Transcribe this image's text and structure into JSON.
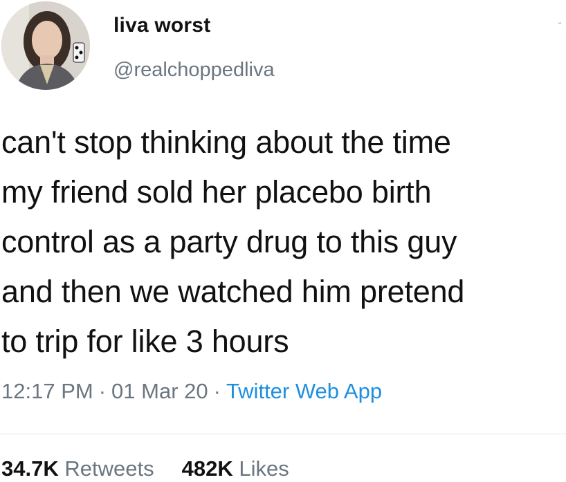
{
  "tweet": {
    "display_name": "liva worst",
    "handle": "@realchoppedliva",
    "text": "can't stop thinking about the time\nmy friend sold her placebo birth\ncontrol as a party drug to this guy\nand then we watched him pretend\nto trip for like 3 hours",
    "time": "12:17 PM",
    "date": "01 Mar 20",
    "source": "Twitter Web App",
    "separator": "·",
    "retweets_count": "34.7K",
    "retweets_label": "Retweets",
    "likes_count": "482K",
    "likes_label": "Likes"
  },
  "colors": {
    "text": "#111111",
    "muted": "#6b7680",
    "link": "#1d8fe0",
    "divider": "#e3e6e8"
  },
  "icons": {
    "avatar": "profile-photo",
    "menu": "chevron-down-icon"
  }
}
